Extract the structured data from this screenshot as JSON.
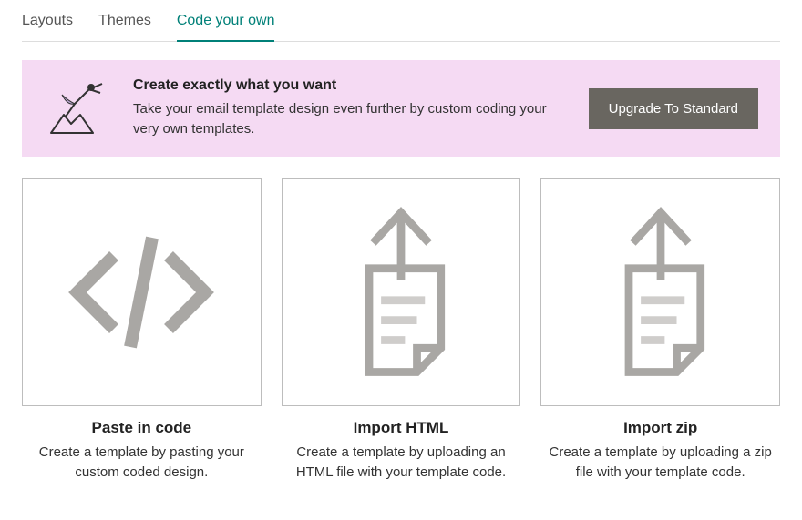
{
  "tabs": {
    "items": [
      {
        "label": "Layouts",
        "active": false
      },
      {
        "label": "Themes",
        "active": false
      },
      {
        "label": "Code your own",
        "active": true
      }
    ]
  },
  "banner": {
    "title": "Create exactly what you want",
    "body": "Take your email template design even further by custom coding your very own templates.",
    "cta_label": "Upgrade To Standard"
  },
  "cards": [
    {
      "icon": "code-icon",
      "title": "Paste in code",
      "desc": "Create a template by pasting your custom coded design."
    },
    {
      "icon": "upload-file-icon",
      "title": "Import HTML",
      "desc": "Create a template by uploading an HTML file with your template code."
    },
    {
      "icon": "upload-file-icon",
      "title": "Import zip",
      "desc": "Create a template by uploading a zip file with your template code."
    }
  ]
}
